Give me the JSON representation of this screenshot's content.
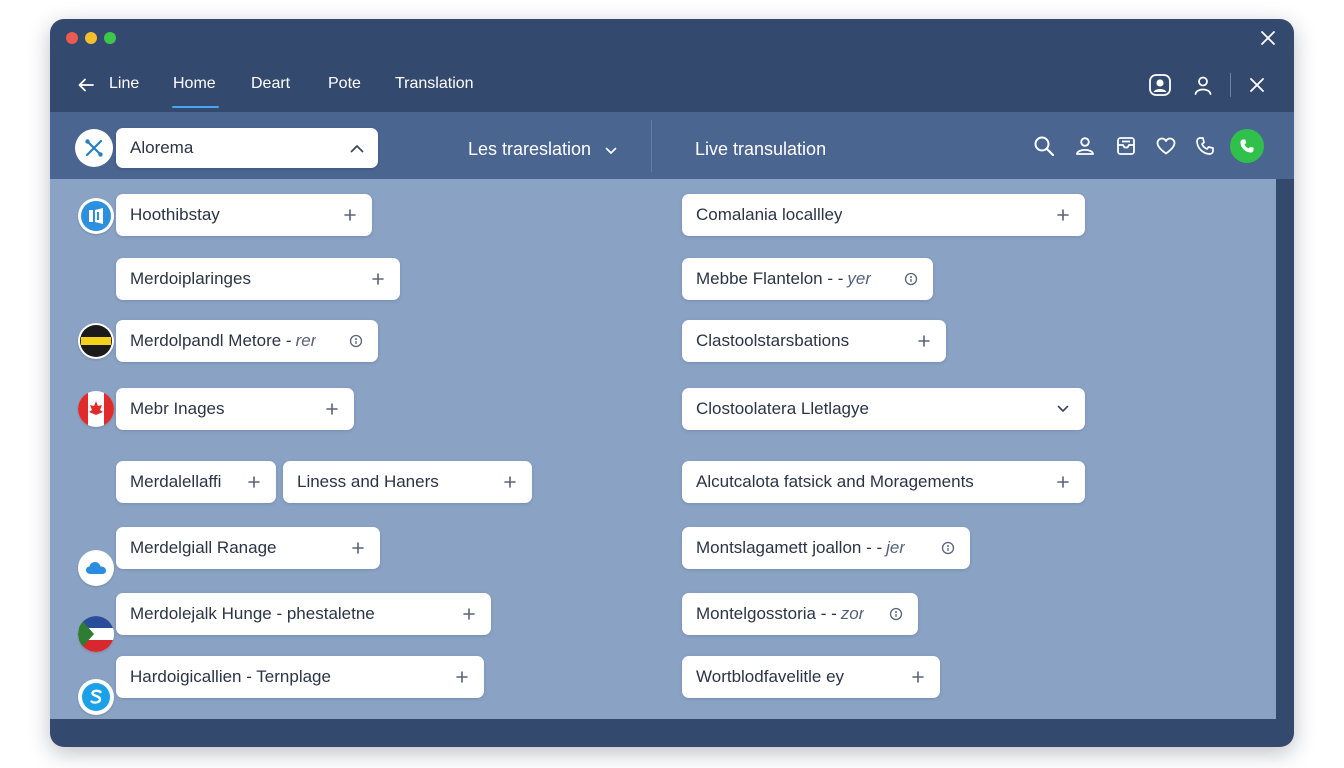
{
  "nav": {
    "tabs": [
      {
        "label": "Line"
      },
      {
        "label": "Home",
        "active": true
      },
      {
        "label": "Deart"
      },
      {
        "label": "Pote"
      },
      {
        "label": "Translation"
      }
    ]
  },
  "toolbar": {
    "select_value": "Alorema",
    "source_label": "Les trareslation",
    "live_label": "Live transulation"
  },
  "left_items": [
    {
      "label": "Hoothibstay",
      "action": "add"
    },
    {
      "label": "Merdoiplaringes",
      "action": "add"
    },
    {
      "label": "Merdolpandl Metore -",
      "suffix": "rer",
      "action": "info"
    },
    {
      "label": "Mebr Inages",
      "action": "add"
    },
    {
      "label": "Merdalellaffi",
      "action": "add"
    },
    {
      "label": "Liness and Haners",
      "action": "add"
    },
    {
      "label": "Merdelgiall Ranage",
      "action": "add"
    },
    {
      "label": "Merdolejalk Hunge - phestaletne",
      "action": "add"
    },
    {
      "label": "Hardoigicallien - Ternplage",
      "action": "add"
    }
  ],
  "right_items": [
    {
      "label": "Comalania locallley",
      "action": "add"
    },
    {
      "label": "Mebbe Flantelon - -",
      "suffix": "yer",
      "action": "info"
    },
    {
      "label": "Clastoolstarsbations",
      "action": "add"
    },
    {
      "label": "Clostoolatera Lletlagye",
      "action": "chevron"
    },
    {
      "label": "Alcutcalota fatsick and Moragements",
      "action": "add"
    },
    {
      "label": "Montslagamett joallon - -",
      "suffix": "jer",
      "action": "info"
    },
    {
      "label": "Montelgosstoria - -",
      "suffix": "zor",
      "action": "info"
    },
    {
      "label": "Wortblodfavelitle ey",
      "action": "add"
    }
  ],
  "icons": {
    "back": "arrow-left-icon",
    "close": "close-icon",
    "account": "user-circle-icon",
    "profile": "user-icon",
    "logo": "tools-icon",
    "search": "search-icon",
    "contacts": "people-icon",
    "inbox": "inbox-icon",
    "favorite": "heart-icon",
    "phone": "phone-icon",
    "call": "call-icon",
    "add": "plus-icon",
    "info": "info-icon",
    "chevron": "chevron-down-icon",
    "caret_up": "chevron-up-icon",
    "caret_down": "caret-down-icon"
  },
  "colors": {
    "window": "#33496e",
    "toolbar": "#4a6590",
    "content": "#8aa2c4",
    "accent": "#4ea3f1",
    "call_button": "#2fc14c"
  }
}
